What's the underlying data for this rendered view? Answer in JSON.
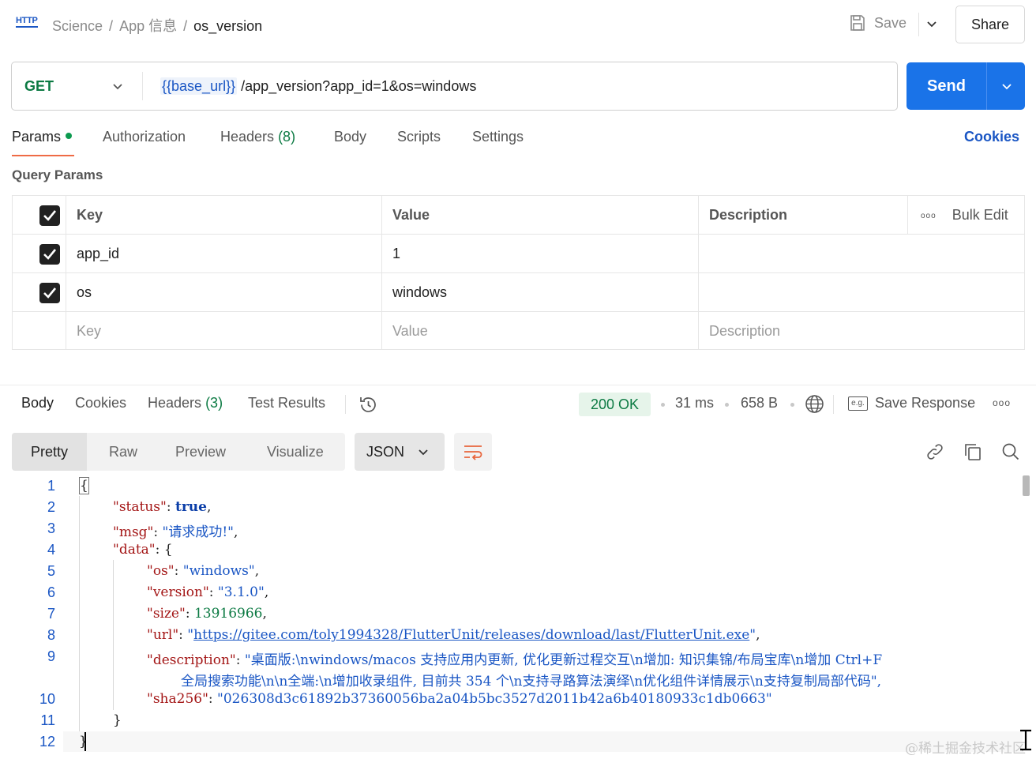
{
  "breadcrumb": {
    "collection": "Science",
    "folder": "App 信息",
    "request": "os_version",
    "separator": "/"
  },
  "header": {
    "http_badge": "HTTP",
    "save_label": "Save",
    "share_label": "Share"
  },
  "request": {
    "method": "GET",
    "url_variable": "{{base_url}}",
    "url_path": "/app_version?app_id=1&os=windows",
    "send_label": "Send"
  },
  "req_tabs": {
    "params": "Params",
    "authorization": "Authorization",
    "headers": "Headers",
    "headers_count": "(8)",
    "body": "Body",
    "scripts": "Scripts",
    "settings": "Settings",
    "cookies": "Cookies"
  },
  "query_params": {
    "title": "Query Params",
    "columns": {
      "key": "Key",
      "value": "Value",
      "description": "Description",
      "bulk_edit": "Bulk Edit"
    },
    "rows": [
      {
        "key": "app_id",
        "value": "1",
        "checked": true
      },
      {
        "key": "os",
        "value": "windows",
        "checked": true
      }
    ],
    "placeholders": {
      "key": "Key",
      "value": "Value",
      "description": "Description"
    }
  },
  "response": {
    "tabs": {
      "body": "Body",
      "cookies": "Cookies",
      "headers": "Headers",
      "headers_count": "(3)",
      "test_results": "Test Results"
    },
    "status": "200 OK",
    "time": "31 ms",
    "size": "658 B",
    "save_response": "Save Response",
    "example_badge": "e.g.",
    "views": {
      "pretty": "Pretty",
      "raw": "Raw",
      "preview": "Preview",
      "visualize": "Visualize"
    },
    "format": "JSON"
  },
  "code": {
    "line_numbers": [
      "1",
      "2",
      "3",
      "4",
      "5",
      "6",
      "7",
      "8",
      "9",
      "10",
      "11",
      "12"
    ],
    "open_brace": "{",
    "close_brace": "}",
    "inner_close": "}",
    "status_key": "\"status\"",
    "status_val": "true",
    "msg_key": "\"msg\"",
    "msg_val": "\"请求成功!\"",
    "data_key": "\"data\"",
    "os_key": "\"os\"",
    "os_val": "\"windows\"",
    "version_key": "\"version\"",
    "version_val": "\"3.1.0\"",
    "size_key": "\"size\"",
    "size_val": "13916966",
    "url_key": "\"url\"",
    "url_val": "https://gitee.com/toly1994328/FlutterUnit/releases/download/last/FlutterUnit.exe",
    "desc_key": "\"description\"",
    "desc_line1": "\"桌面版:\\nwindows/macos 支持应用内更新, 优化更新过程交互\\n增加: 知识集锦/布局宝库\\n增加 Ctrl+F",
    "desc_line2": "全局搜索功能\\n\\n全端:\\n增加收录组件, 目前共 354 个\\n支持寻路算法演绎\\n优化组件详情展示\\n支持复制局部代码\",",
    "sha_key": "\"sha256\"",
    "sha_val": "\"026308d3c61892b37360056ba2a04b5bc3527d2011b42a6b40180933c1db0663\""
  },
  "watermark": "@稀土掘金技术社区"
}
